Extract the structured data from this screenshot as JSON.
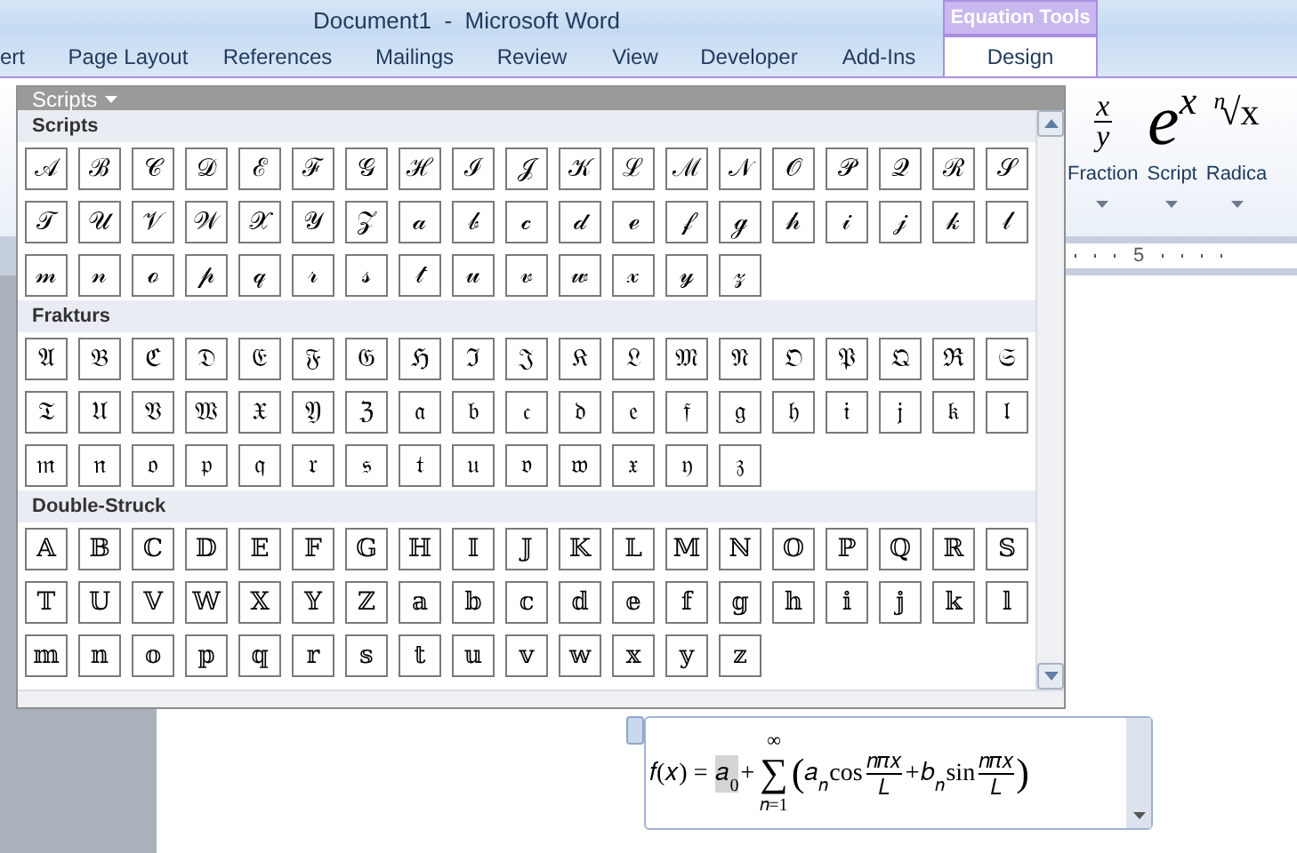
{
  "window": {
    "title": "Document1  -  Microsoft Word"
  },
  "tabs": [
    {
      "label": "ert",
      "selected": false
    },
    {
      "label": "Page Layout",
      "selected": false
    },
    {
      "label": "References",
      "selected": false
    },
    {
      "label": "Mailings",
      "selected": false
    },
    {
      "label": "Review",
      "selected": false
    },
    {
      "label": "View",
      "selected": false
    },
    {
      "label": "Developer",
      "selected": false
    },
    {
      "label": "Add-Ins",
      "selected": false
    },
    {
      "label": "Design",
      "selected": true,
      "context": "Equation Tools"
    }
  ],
  "ribbon": {
    "buttons": [
      {
        "kind": "fraction",
        "label": "Fraction",
        "glyphs": [
          "x",
          "y"
        ]
      },
      {
        "kind": "script",
        "label": "Script",
        "glyphs": [
          "e",
          "x"
        ]
      },
      {
        "kind": "radical",
        "label": "Radica",
        "glyphs": [
          "n",
          "√x"
        ]
      }
    ]
  },
  "ruler": {
    "label": "5"
  },
  "gallery": {
    "title": "Scripts",
    "sections": [
      {
        "title": "Scripts",
        "symbols": [
          "𝒜",
          "ℬ",
          "𝒞",
          "𝒟",
          "ℰ",
          "ℱ",
          "𝒢",
          "ℋ",
          "ℐ",
          "𝒥",
          "𝒦",
          "ℒ",
          "ℳ",
          "𝒩",
          "𝒪",
          "𝒫",
          "𝒬",
          "ℛ",
          "𝒮",
          "𝒯",
          "𝒰",
          "𝒱",
          "𝒲",
          "𝒳",
          "𝒴",
          "𝒵",
          "𝒶",
          "𝒷",
          "𝒸",
          "𝒹",
          "ℯ",
          "𝒻",
          "ℊ",
          "𝒽",
          "𝒾",
          "𝒿",
          "𝓀",
          "𝓁",
          "𝓂",
          "𝓃",
          "ℴ",
          "𝓅",
          "𝓆",
          "𝓇",
          "𝓈",
          "𝓉",
          "𝓊",
          "𝓋",
          "𝓌",
          "𝓍",
          "𝓎",
          "𝓏"
        ]
      },
      {
        "title": "Frakturs",
        "symbols": [
          "𝔄",
          "𝔅",
          "ℭ",
          "𝔇",
          "𝔈",
          "𝔉",
          "𝔊",
          "ℌ",
          "ℑ",
          "𝔍",
          "𝔎",
          "𝔏",
          "𝔐",
          "𝔑",
          "𝔒",
          "𝔓",
          "𝔔",
          "ℜ",
          "𝔖",
          "𝔗",
          "𝔘",
          "𝔙",
          "𝔚",
          "𝔛",
          "𝔜",
          "ℨ",
          "𝔞",
          "𝔟",
          "𝔠",
          "𝔡",
          "𝔢",
          "𝔣",
          "𝔤",
          "𝔥",
          "𝔦",
          "𝔧",
          "𝔨",
          "𝔩",
          "𝔪",
          "𝔫",
          "𝔬",
          "𝔭",
          "𝔮",
          "𝔯",
          "𝔰",
          "𝔱",
          "𝔲",
          "𝔳",
          "𝔴",
          "𝔵",
          "𝔶",
          "𝔷"
        ]
      },
      {
        "title": "Double-Struck",
        "symbols": [
          "𝔸",
          "𝔹",
          "ℂ",
          "𝔻",
          "𝔼",
          "𝔽",
          "𝔾",
          "ℍ",
          "𝕀",
          "𝕁",
          "𝕂",
          "𝕃",
          "𝕄",
          "ℕ",
          "𝕆",
          "ℙ",
          "ℚ",
          "ℝ",
          "𝕊",
          "𝕋",
          "𝕌",
          "𝕍",
          "𝕎",
          "𝕏",
          "𝕐",
          "ℤ",
          "𝕒",
          "𝕓",
          "𝕔",
          "𝕕",
          "𝕖",
          "𝕗",
          "𝕘",
          "𝕙",
          "𝕚",
          "𝕛",
          "𝕜",
          "𝕝",
          "𝕞",
          "𝕟",
          "𝕠",
          "𝕡",
          "𝕢",
          "𝕣",
          "𝕤",
          "𝕥",
          "𝕦",
          "𝕧",
          "𝕨",
          "𝕩",
          "𝕪",
          "𝕫"
        ]
      }
    ]
  },
  "equation": {
    "tokens": [
      {
        "kind": "text",
        "text": "𝑓(𝑥) = ",
        "highlighted": false
      },
      {
        "kind": "sub",
        "base": "𝑎",
        "sub": "0",
        "highlighted": true
      },
      {
        "kind": "text",
        "text": "+",
        "highlighted": false
      },
      {
        "kind": "sum",
        "symbol": "∑",
        "upper": "∞",
        "lower": "𝑛=1",
        "highlighted": false
      },
      {
        "kind": "big",
        "text": "(",
        "highlighted": false
      },
      {
        "kind": "sub",
        "base": "𝑎",
        "sub": "𝑛",
        "highlighted": false
      },
      {
        "kind": "text",
        "text": "cos",
        "highlighted": false
      },
      {
        "kind": "frac",
        "num": "𝑛𝜋𝑥",
        "den": "𝐿",
        "highlighted": false
      },
      {
        "kind": "text",
        "text": "+",
        "highlighted": false
      },
      {
        "kind": "sub",
        "base": "𝑏",
        "sub": "𝑛",
        "highlighted": false
      },
      {
        "kind": "text",
        "text": "sin",
        "highlighted": false
      },
      {
        "kind": "frac",
        "num": "𝑛𝜋𝑥",
        "den": "𝐿",
        "highlighted": false
      },
      {
        "kind": "big",
        "text": ")",
        "highlighted": false
      }
    ]
  }
}
